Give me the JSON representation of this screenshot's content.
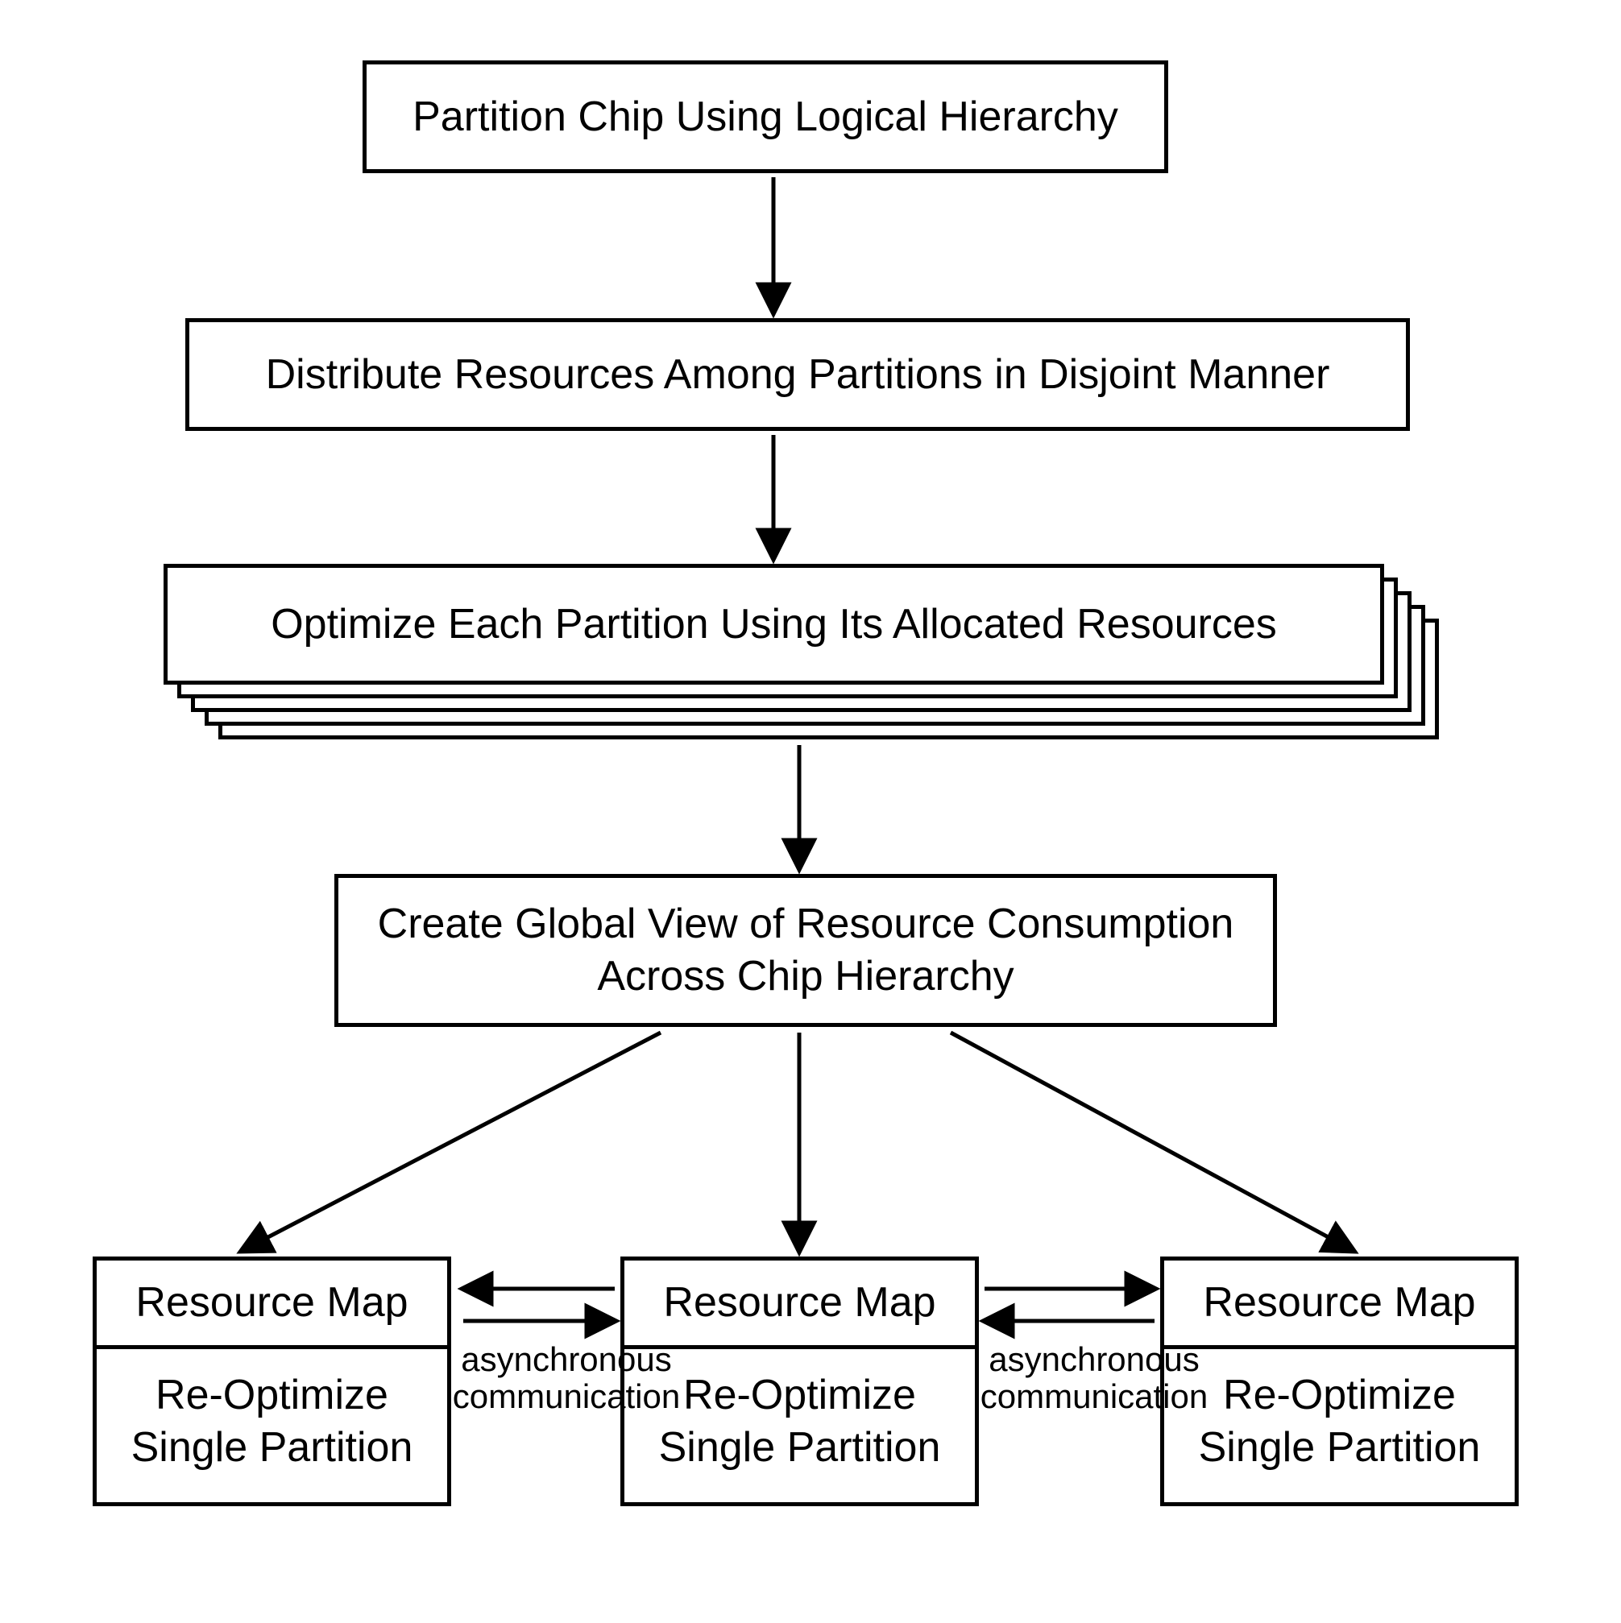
{
  "steps": {
    "s1": "Partition Chip Using Logical Hierarchy",
    "s2": "Distribute Resources Among Partitions in Disjoint Manner",
    "s3": "Optimize Each Partition Using Its Allocated Resources",
    "s4": "Create Global View of Resource Consumption\nAcross Chip Hierarchy"
  },
  "partition": {
    "top": "Resource Map",
    "bottom": "Re-Optimize\nSingle Partition"
  },
  "edge_label": "asynchronous\ncommunication"
}
